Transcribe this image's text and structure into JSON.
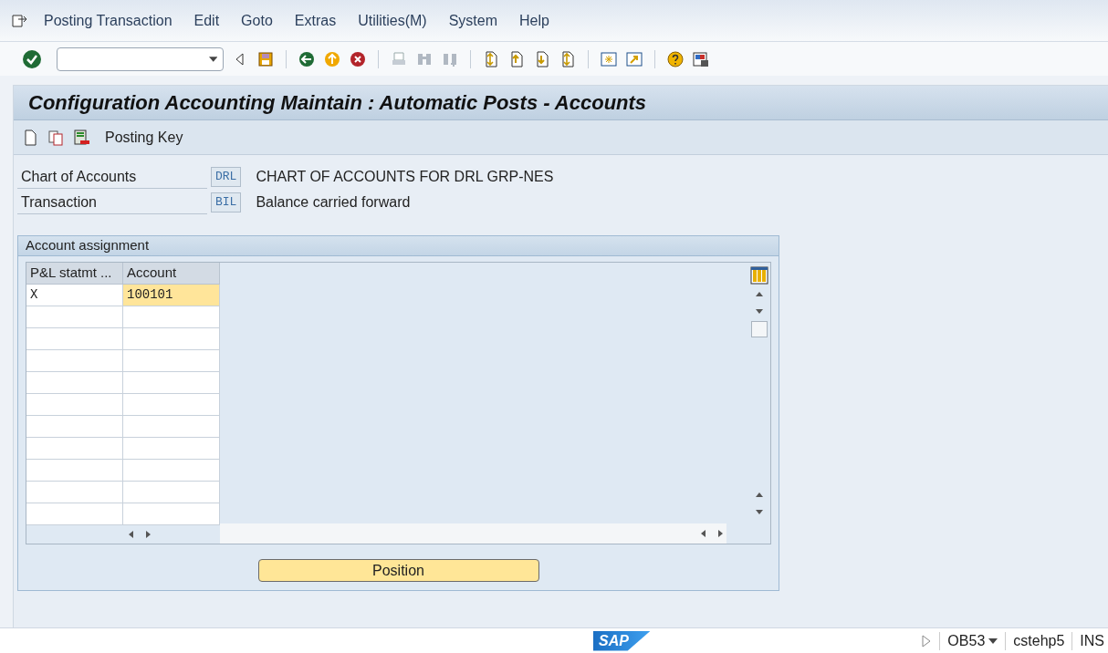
{
  "menu": [
    "Posting Transaction",
    "Edit",
    "Goto",
    "Extras",
    "Utilities(M)",
    "System",
    "Help"
  ],
  "title": "Configuration Accounting Maintain : Automatic Posts - Accounts",
  "app_toolbar": {
    "label": "Posting Key"
  },
  "fields": [
    {
      "label": "Chart of Accounts",
      "value": "DRL",
      "description": "CHART OF ACCOUNTS FOR DRL GRP-NES"
    },
    {
      "label": "Transaction",
      "value": "BIL",
      "description": "Balance carried forward"
    }
  ],
  "group": {
    "title": "Account assignment",
    "columns": [
      "P&L statmt ...",
      "Account"
    ],
    "rows": [
      {
        "cells": [
          "X",
          "100101"
        ],
        "selected": true
      }
    ],
    "button": "Position"
  },
  "status_bar": {
    "logo": "SAP",
    "transaction": "OB53",
    "server": "cstehp5",
    "mode": "INS"
  }
}
